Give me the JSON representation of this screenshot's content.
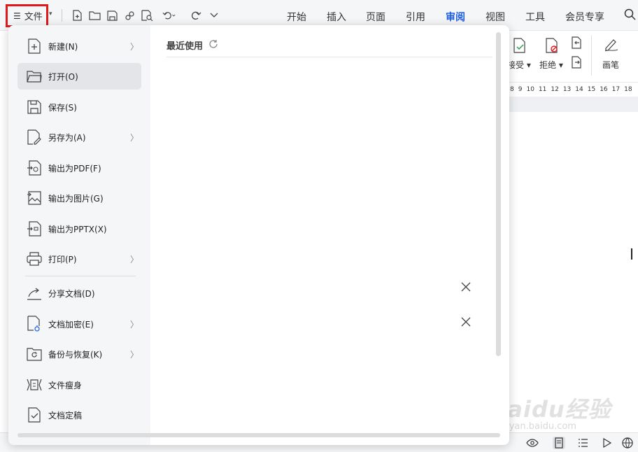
{
  "toolbar": {
    "file_label": "文件",
    "tabs": [
      "开始",
      "插入",
      "页面",
      "引用",
      "审阅",
      "视图",
      "工具",
      "会员专享"
    ],
    "active_tab": "审阅",
    "quick_access_icons": [
      "new-file-icon",
      "open-folder-icon",
      "save-icon",
      "link-icon",
      "print-preview-icon",
      "undo-icon",
      "redo-icon",
      "more-chevron-icon"
    ]
  },
  "ribbon": {
    "accept_label": "接受",
    "reject_label": "拒绝",
    "pen_label": "画笔"
  },
  "ruler": {
    "numbers": [
      "8",
      "9",
      "10",
      "11",
      "12",
      "13",
      "14",
      "15",
      "16",
      "17",
      "18"
    ]
  },
  "file_menu": {
    "items": [
      {
        "label": "新建(N)",
        "icon": "new-doc-icon",
        "has_submenu": true
      },
      {
        "label": "打开(O)",
        "icon": "open-folder-icon",
        "has_submenu": false,
        "active": true
      },
      {
        "label": "保存(S)",
        "icon": "save-icon",
        "has_submenu": false
      },
      {
        "label": "另存为(A)",
        "icon": "save-as-icon",
        "has_submenu": true
      },
      {
        "label": "输出为PDF(F)",
        "icon": "export-pdf-icon",
        "has_submenu": false
      },
      {
        "label": "输出为图片(G)",
        "icon": "export-image-icon",
        "has_submenu": false
      },
      {
        "label": "输出为PPTX(X)",
        "icon": "export-pptx-icon",
        "has_submenu": false
      },
      {
        "label": "打印(P)",
        "icon": "printer-icon",
        "has_submenu": true
      },
      {
        "label": "分享文档(D)",
        "icon": "share-icon",
        "has_submenu": false
      },
      {
        "label": "文档加密(E)",
        "icon": "encrypt-icon",
        "has_submenu": true
      },
      {
        "label": "备份与恢复(K)",
        "icon": "backup-icon",
        "has_submenu": true
      },
      {
        "label": "文件瘦身",
        "icon": "slim-file-icon",
        "has_submenu": false
      },
      {
        "label": "文档定稿",
        "icon": "finalize-icon",
        "has_submenu": false
      }
    ]
  },
  "recent": {
    "title": "最近使用"
  },
  "watermark": {
    "brand": "Baidu经验",
    "url": "jingyan.baidu.com"
  },
  "colors": {
    "accent": "#1e5ee6",
    "highlight_border": "#e0191d",
    "menu_bg": "#f5f6f8"
  }
}
